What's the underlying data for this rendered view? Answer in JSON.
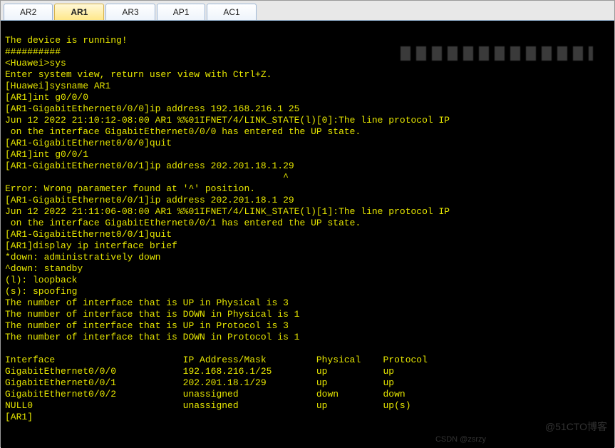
{
  "tabs": [
    {
      "label": "AR2",
      "active": false
    },
    {
      "label": "AR1",
      "active": true
    },
    {
      "label": "AR3",
      "active": false
    },
    {
      "label": "AP1",
      "active": false
    },
    {
      "label": "AC1",
      "active": false
    }
  ],
  "watermarks": {
    "wm1": "@51CTO博客",
    "wm2": "CSDN @zsrzy"
  },
  "terminal": {
    "lines": [
      "The device is running!",
      "##########",
      "<Huawei>sys",
      "Enter system view, return user view with Ctrl+Z.",
      "[Huawei]sysname AR1",
      "[AR1]int g0/0/0",
      "[AR1-GigabitEthernet0/0/0]ip address 192.168.216.1 25",
      "Jun 12 2022 21:10:12-08:00 AR1 %%01IFNET/4/LINK_STATE(l)[0]:The line protocol IP",
      " on the interface GigabitEthernet0/0/0 has entered the UP state.",
      "[AR1-GigabitEthernet0/0/0]quit",
      "[AR1]int g0/0/1",
      "[AR1-GigabitEthernet0/0/1]ip address 202.201.18.1.29",
      "                                                  ^",
      "Error: Wrong parameter found at '^' position.",
      "[AR1-GigabitEthernet0/0/1]ip address 202.201.18.1 29",
      "Jun 12 2022 21:11:06-08:00 AR1 %%01IFNET/4/LINK_STATE(l)[1]:The line protocol IP",
      " on the interface GigabitEthernet0/0/1 has entered the UP state.",
      "[AR1-GigabitEthernet0/0/1]quit",
      "[AR1]display ip interface brief",
      "*down: administratively down",
      "^down: standby",
      "(l): loopback",
      "(s): spoofing",
      "The number of interface that is UP in Physical is 3",
      "The number of interface that is DOWN in Physical is 1",
      "The number of interface that is UP in Protocol is 3",
      "The number of interface that is DOWN in Protocol is 1",
      ""
    ],
    "table": {
      "headers": [
        "Interface",
        "IP Address/Mask",
        "Physical",
        "Protocol"
      ],
      "rows": [
        [
          "GigabitEthernet0/0/0",
          "192.168.216.1/25",
          "up",
          "up"
        ],
        [
          "GigabitEthernet0/0/1",
          "202.201.18.1/29",
          "up",
          "up"
        ],
        [
          "GigabitEthernet0/0/2",
          "unassigned",
          "down",
          "down"
        ],
        [
          "NULL0",
          "unassigned",
          "up",
          "up(s)"
        ]
      ]
    },
    "final_prompt": "[AR1]"
  }
}
